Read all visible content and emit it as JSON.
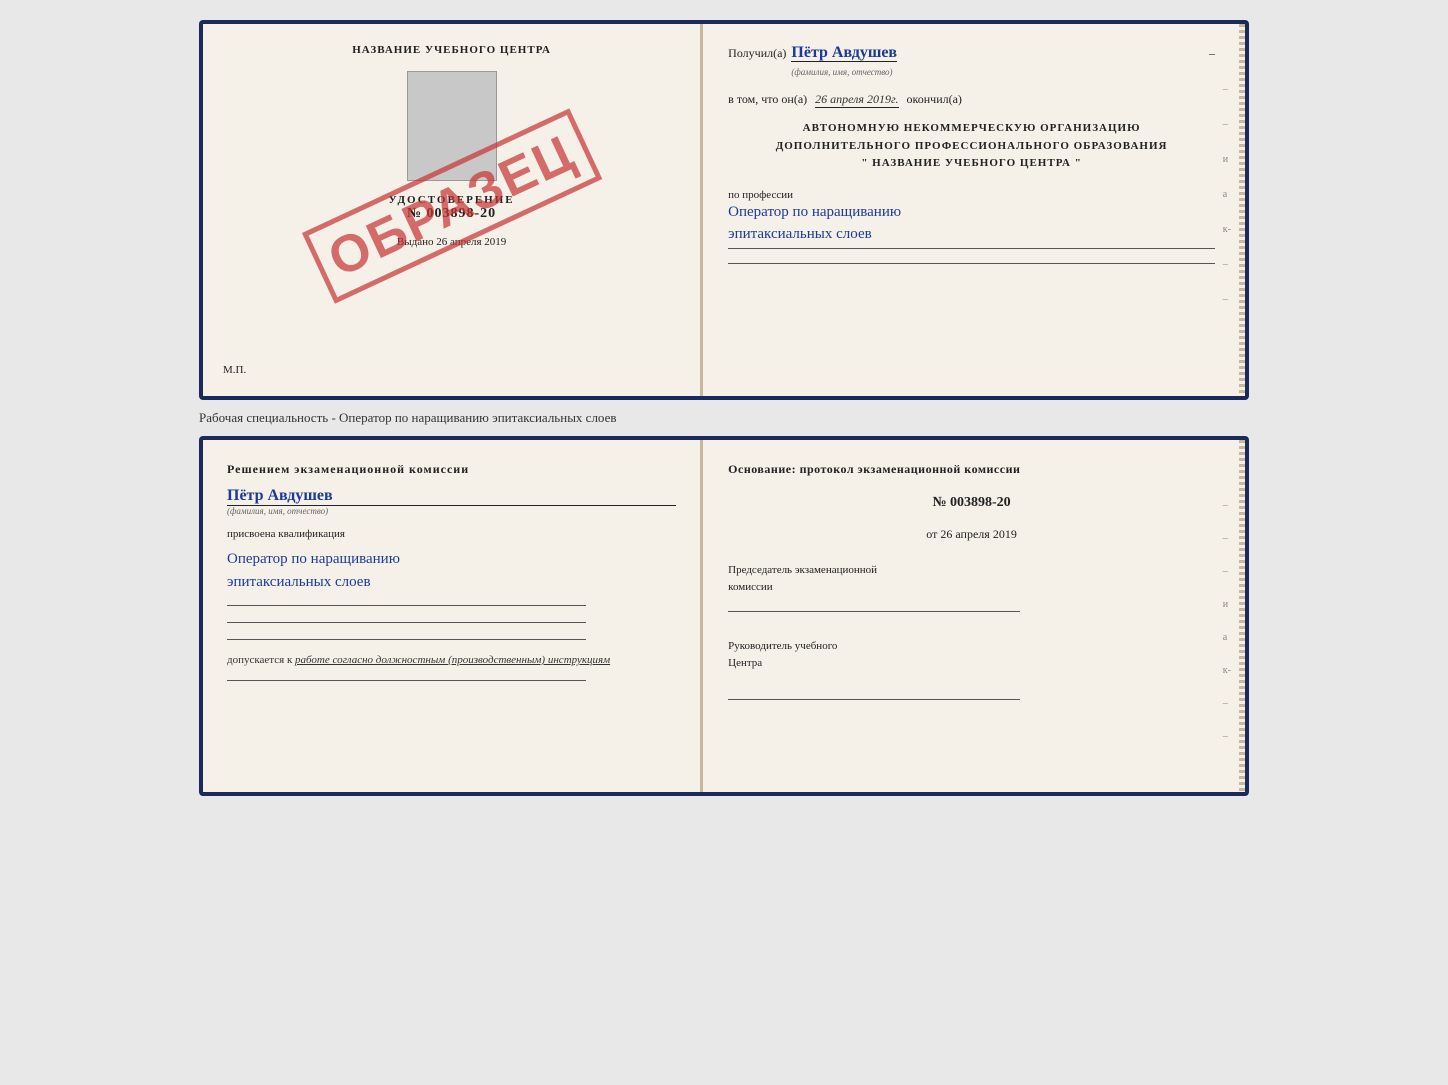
{
  "page": {
    "background": "#e8e8e8"
  },
  "diploma": {
    "left": {
      "title": "НАЗВАНИЕ УЧЕБНОГО ЦЕНТРА",
      "cert_label": "УДОСТОВЕРЕНИЕ",
      "cert_number": "№ 003898-20",
      "issued_prefix": "Выдано",
      "issued_date": "26 апреля 2019",
      "mp_label": "М.П.",
      "stamp": "ОБРАЗЕЦ"
    },
    "right": {
      "recipient_prefix": "Получил(а)",
      "recipient_name": "Пётр Авдушев",
      "recipient_subtitle": "(фамилия, имя, отчество)",
      "dash": "–",
      "completed_prefix": "в том, что он(а)",
      "completed_date": "26 апреля 2019г.",
      "completed_suffix": "окончил(а)",
      "org_line1": "АВТОНОМНУЮ НЕКОММЕРЧЕСКУЮ ОРГАНИЗАЦИЮ",
      "org_line2": "ДОПОЛНИТЕЛЬНОГО ПРОФЕССИОНАЛЬНОГО ОБРАЗОВАНИЯ",
      "org_line3": "\"  НАЗВАНИЕ УЧЕБНОГО ЦЕНТРА  \"",
      "profession_label": "по профессии",
      "profession_text_line1": "Оператор по наращиванию",
      "profession_text_line2": "эпитаксиальных слоев"
    }
  },
  "middle": {
    "text": "Рабочая специальность - Оператор по наращиванию эпитаксиальных слоев"
  },
  "bottom_cert": {
    "left": {
      "commission_title": "Решением  экзаменационной  комиссии",
      "person_name": "Пётр Авдушев",
      "person_subtitle": "(фамилия, имя, отчество)",
      "assigned_label": "присвоена квалификация",
      "qualification_line1": "Оператор по наращиванию",
      "qualification_line2": "эпитаксиальных слоев",
      "admission_prefix": "допускается к",
      "admission_italic": "работе согласно должностным (производственным) инструкциям"
    },
    "right": {
      "basis_label": "Основание: протокол экзаменационной  комиссии",
      "protocol_number": "№  003898-20",
      "protocol_date_prefix": "от",
      "protocol_date": "26 апреля 2019",
      "chairman_label_line1": "Председатель экзаменационной",
      "chairman_label_line2": "комиссии",
      "head_label_line1": "Руководитель учебного",
      "head_label_line2": "Центра"
    }
  }
}
